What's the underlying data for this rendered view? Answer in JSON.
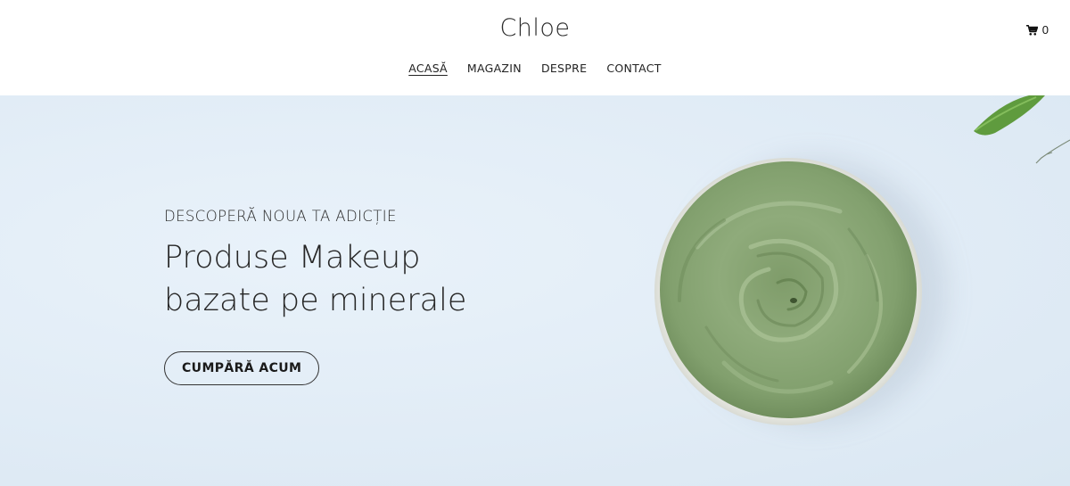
{
  "header": {
    "brand": "Chloe",
    "nav": [
      {
        "label": "ACASĂ",
        "active": true
      },
      {
        "label": "MAGAZIN",
        "active": false
      },
      {
        "label": "DESPRE",
        "active": false
      },
      {
        "label": "CONTACT",
        "active": false
      }
    ],
    "cart": {
      "icon": "shopping-cart-icon",
      "count": "0"
    }
  },
  "hero": {
    "eyebrow": "DESCOPERĂ NOUA TA ADICȚIE",
    "headline": "Produse Makeup bazate pe minerale",
    "cta_label": "CUMPĂRĂ ACUM",
    "image": "green-clay-mask-bowl",
    "colors": {
      "background": "#e1ecf6",
      "clay": "#8aa776",
      "leaf": "#5f9b3e"
    }
  }
}
